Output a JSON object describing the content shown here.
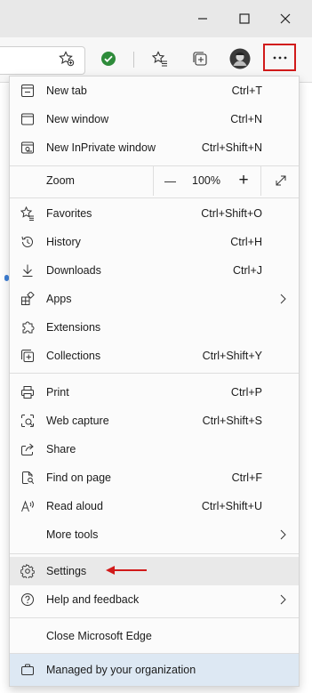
{
  "window": {
    "minimize_icon": "minimize-icon",
    "maximize_icon": "maximize-icon",
    "close_icon": "close-icon"
  },
  "toolbar": {
    "icons": [
      "add-favorite-icon",
      "extension-check-icon",
      "favorites-icon",
      "collections-icon",
      "profile-avatar",
      "more-options-icon"
    ],
    "accent": "#d11a1a"
  },
  "menu": {
    "new_tab": {
      "label": "New tab",
      "shortcut": "Ctrl+T"
    },
    "new_window": {
      "label": "New window",
      "shortcut": "Ctrl+N"
    },
    "new_inprivate": {
      "label": "New InPrivate window",
      "shortcut": "Ctrl+Shift+N"
    },
    "zoom": {
      "label": "Zoom",
      "minus": "—",
      "value": "100%",
      "plus": "+"
    },
    "favorites": {
      "label": "Favorites",
      "shortcut": "Ctrl+Shift+O"
    },
    "history": {
      "label": "History",
      "shortcut": "Ctrl+H"
    },
    "downloads": {
      "label": "Downloads",
      "shortcut": "Ctrl+J"
    },
    "apps": {
      "label": "Apps"
    },
    "extensions": {
      "label": "Extensions"
    },
    "collections": {
      "label": "Collections",
      "shortcut": "Ctrl+Shift+Y"
    },
    "print": {
      "label": "Print",
      "shortcut": "Ctrl+P"
    },
    "web_capture": {
      "label": "Web capture",
      "shortcut": "Ctrl+Shift+S"
    },
    "share": {
      "label": "Share"
    },
    "find_on_page": {
      "label": "Find on page",
      "shortcut": "Ctrl+F"
    },
    "read_aloud": {
      "label": "Read aloud",
      "shortcut": "Ctrl+Shift+U"
    },
    "more_tools": {
      "label": "More tools"
    },
    "settings": {
      "label": "Settings"
    },
    "help_feedback": {
      "label": "Help and feedback"
    },
    "close_edge": {
      "label": "Close Microsoft Edge"
    },
    "managed": {
      "label": "Managed by your organization"
    }
  },
  "colors": {
    "highlight": "#e9e9e9",
    "managed_bg": "#dde8f3",
    "annotation_arrow": "#d11a1a",
    "check_green": "#2e8b3a"
  }
}
